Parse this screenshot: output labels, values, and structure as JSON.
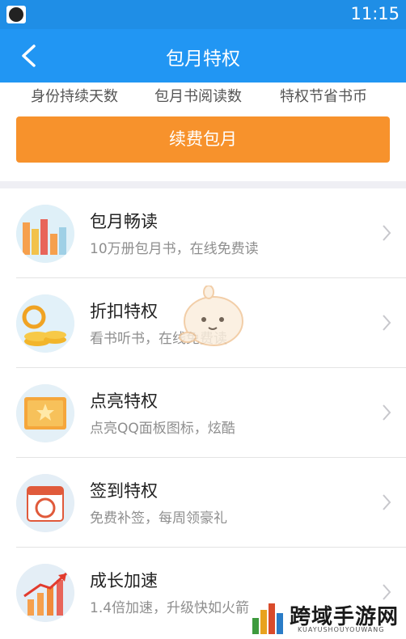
{
  "status_bar": {
    "time": "11:15"
  },
  "nav": {
    "title": "包月特权"
  },
  "stats": {
    "items": [
      "身份持续天数",
      "包月书阅读数",
      "特权节省书币"
    ]
  },
  "renew": {
    "label": "续费包月"
  },
  "privileges": [
    {
      "name": "包月畅读",
      "desc": "10万册包月书，在线免费读",
      "icon": "books-chart-icon"
    },
    {
      "name": "折扣特权",
      "desc": "看书听书，在线免费读",
      "icon": "discount-coins-icon"
    },
    {
      "name": "点亮特权",
      "desc": "点亮QQ面板图标，炫酷",
      "icon": "light-up-card-icon"
    },
    {
      "name": "签到特权",
      "desc": "免费补签，每周领豪礼",
      "icon": "calendar-sign-icon"
    },
    {
      "name": "成长加速",
      "desc": "1.4倍加速，升级快如火箭",
      "icon": "growth-arrow-icon"
    }
  ],
  "watermark": {
    "title": "跨域手游网",
    "subtitle": "KUAYUSHOUYOUWANG"
  },
  "colors": {
    "nav_blue": "#2196f3",
    "accent_orange": "#f7922c"
  }
}
